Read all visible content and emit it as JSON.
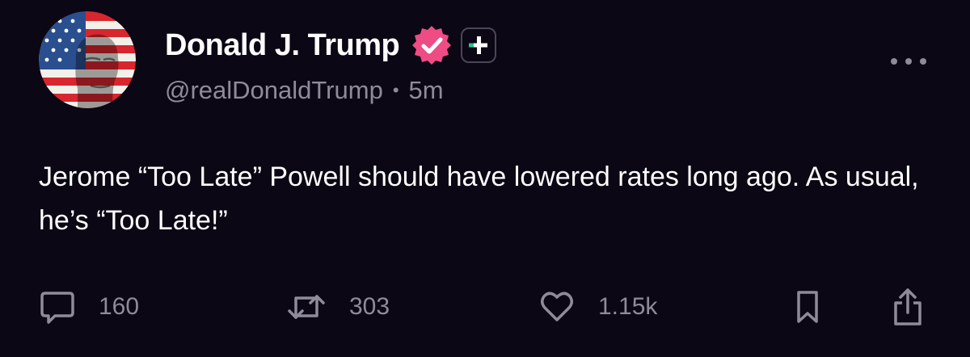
{
  "post": {
    "author": {
      "display_name": "Donald J. Trump",
      "handle": "@realDonaldTrump",
      "separator": "•",
      "timestamp": "5m",
      "avatar_icon": "flag-portrait-avatar",
      "verified_icon": "verified-badge-icon",
      "plus_icon": "plus-subscribe-icon"
    },
    "body": "Jerome “Too Late” Powell should have lowered rates long ago. As usual, he’s “Too Late!”",
    "stats": {
      "replies": "160",
      "reposts": "303",
      "likes": "1.15k"
    }
  },
  "colors": {
    "background": "#0b0714",
    "text_primary": "#ffffff",
    "text_secondary": "#8f8b9a",
    "verified_pink": "#ee4c84",
    "plus_green": "#25c98b"
  }
}
